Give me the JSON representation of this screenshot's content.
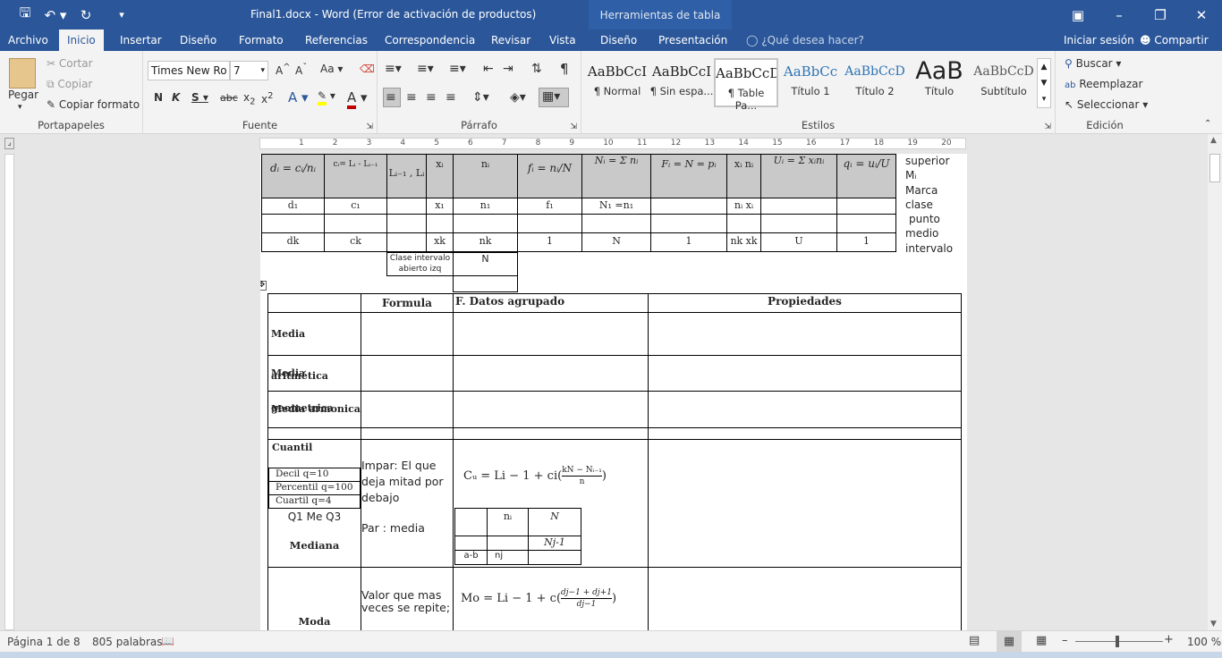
{
  "window": {
    "title": "Final1.docx - Word (Error de activación de productos)",
    "table_tools": "Herramientas de tabla"
  },
  "tabs": {
    "file": "Archivo",
    "home": "Inicio",
    "insert": "Insertar",
    "design": "Diseño",
    "format": "Formato",
    "references": "Referencias",
    "mailings": "Correspondencia",
    "review": "Revisar",
    "view": "Vista",
    "table_design": "Diseño",
    "layout": "Presentación",
    "tell_me": "¿Qué desea hacer?",
    "signin": "Iniciar sesión",
    "share": "Compartir"
  },
  "clipboard": {
    "paste": "Pegar",
    "cut": "Cortar",
    "copy": "Copiar",
    "format_painter": "Copiar formato",
    "label": "Portapapeles"
  },
  "font": {
    "name": "Times New Ro",
    "size": "7",
    "label": "Fuente"
  },
  "paragraph": {
    "label": "Párrafo"
  },
  "styles": {
    "label": "Estilos",
    "items": [
      {
        "preview": "AaBbCcI",
        "name": "¶ Normal"
      },
      {
        "preview": "AaBbCcI",
        "name": "¶ Sin espa..."
      },
      {
        "preview": "AaBbCcD",
        "name": "¶ Table Pa..."
      },
      {
        "preview": "AaBbCc",
        "name": "Título 1"
      },
      {
        "preview": "AaBbCcD",
        "name": "Título 2"
      },
      {
        "preview": "AaB",
        "name": "Título"
      },
      {
        "preview": "AaBbCcD",
        "name": "Subtítulo"
      }
    ]
  },
  "editing": {
    "find": "Buscar",
    "replace": "Reemplazar",
    "select": "Seleccionar",
    "label": "Edición"
  },
  "ruler": {
    "ticks": [
      "1",
      "2",
      "3",
      "4",
      "5",
      "6",
      "7",
      "8",
      "9",
      "10",
      "11",
      "12",
      "13",
      "14",
      "15",
      "16",
      "17",
      "18",
      "19",
      "20"
    ]
  },
  "doc": {
    "top_table": {
      "headers": [
        "dᵢ = cᵢ/nᵢ",
        "cᵢ= Lᵢ - Lᵢ₋₁",
        "Lᵢ₋₁ , Lᵢ",
        "xᵢ",
        "nᵢ",
        "fᵢ = nᵢ/N",
        "Nᵢ = Σ nᵢ",
        "Fᵢ = N = pᵢ",
        "xᵢ nᵢ",
        "Uᵢ = Σ xᵢnᵢ",
        "qᵢ = uᵢ/U"
      ],
      "rows": [
        [
          "d₁",
          "c₁",
          "",
          "x₁",
          "n₁",
          "f₁",
          "N₁ =n₁",
          "",
          "nᵢ xᵢ",
          "",
          ""
        ],
        [
          "",
          "",
          "",
          "",
          "",
          "",
          "",
          "",
          "",
          "",
          ""
        ],
        [
          "dk",
          "ck",
          "",
          "xk",
          "nk",
          "1",
          "N",
          "1",
          "nk xk",
          "U",
          "1"
        ]
      ],
      "side_notes": [
        "superior",
        "Mᵢ",
        "Marca",
        "clase",
        "punto",
        "medio",
        "intervalo"
      ],
      "extra_label": "Clase intervalo abierto izq",
      "extra_value": "N"
    },
    "main_table": {
      "headers": [
        "Formula",
        "F. Datos agrupado",
        "Propiedades"
      ],
      "rows": [
        "Media aritmética",
        "Media geometrica",
        "Media armonica"
      ],
      "cuantil": {
        "title": "Cuantil",
        "decil": "Decil  q=10",
        "percentil": "Percentil q=100",
        "cuartil": "Cuartil  q=4",
        "q": "Q1 Me Q3",
        "mediana": "Mediana",
        "odd": "Impar: El que deja mitad por debajo",
        "even": "Par : media",
        "formula": "Cᵤ = Li − 1 + ci(",
        "frac_num": "kN − Nᵢ₋₁",
        "frac_den": "n",
        "inner": {
          "h1": "nᵢ",
          "h2": "N",
          "nj1": "Nj-1",
          "ab": "a-b",
          "nj": "nj"
        }
      },
      "moda": {
        "title": "Moda",
        "desc": "Valor que mas veces se repite;",
        "formula": "Mo = Li − 1 + c(",
        "frac_num": "dj−1 + dj+1",
        "frac_den": "dj−1"
      }
    }
  },
  "status": {
    "page": "Página 1 de 8",
    "words": "805 palabras",
    "zoom": "100 %"
  }
}
